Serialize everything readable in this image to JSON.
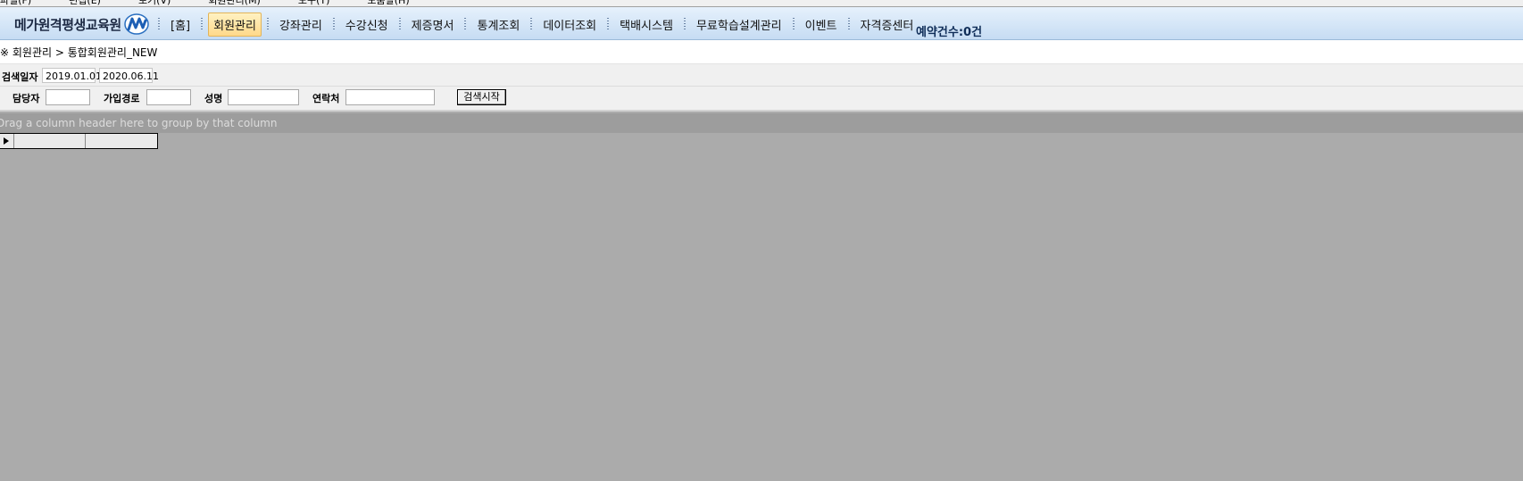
{
  "menubar": {
    "items": [
      "파일(F)",
      "편집(E)",
      "보기(V)",
      "회원관리(M)",
      "도구(T)",
      "도움말(H)"
    ]
  },
  "header": {
    "logo_text": "메가원격평생교육원",
    "nav_items": [
      {
        "label": "[홈]",
        "active": false
      },
      {
        "label": "회원관리",
        "active": true
      },
      {
        "label": "강좌관리",
        "active": false
      },
      {
        "label": "수강신청",
        "active": false
      },
      {
        "label": "제증명서",
        "active": false
      },
      {
        "label": "통계조회",
        "active": false
      },
      {
        "label": "데이터조회",
        "active": false
      },
      {
        "label": "택배시스템",
        "active": false
      },
      {
        "label": "무료학습설계관리",
        "active": false
      },
      {
        "label": "이벤트",
        "active": false
      },
      {
        "label": "자격증센터",
        "active": false
      }
    ],
    "reservation": "예약건수:0건"
  },
  "breadcrumb": "※ 회원관리 > 통합회원관리_NEW",
  "filters": {
    "search_date_label": "검색일자",
    "date_from": "2019.01.01",
    "date_to": "2020.06.11",
    "manager_label": "담당자",
    "manager_value": "",
    "join_path_label": "가입경로",
    "join_path_value": "",
    "name_label": "성명",
    "name_value": "",
    "contact_label": "연락처",
    "contact_value": "",
    "search_button": "검색시작"
  },
  "grid": {
    "group_hint": "Drag a column header here to group by that column",
    "columns": [
      "",
      ""
    ]
  },
  "colors": {
    "header_bg": "#c6dcf3",
    "active_tab": "#ffd98a",
    "workspace": "#ababab"
  }
}
